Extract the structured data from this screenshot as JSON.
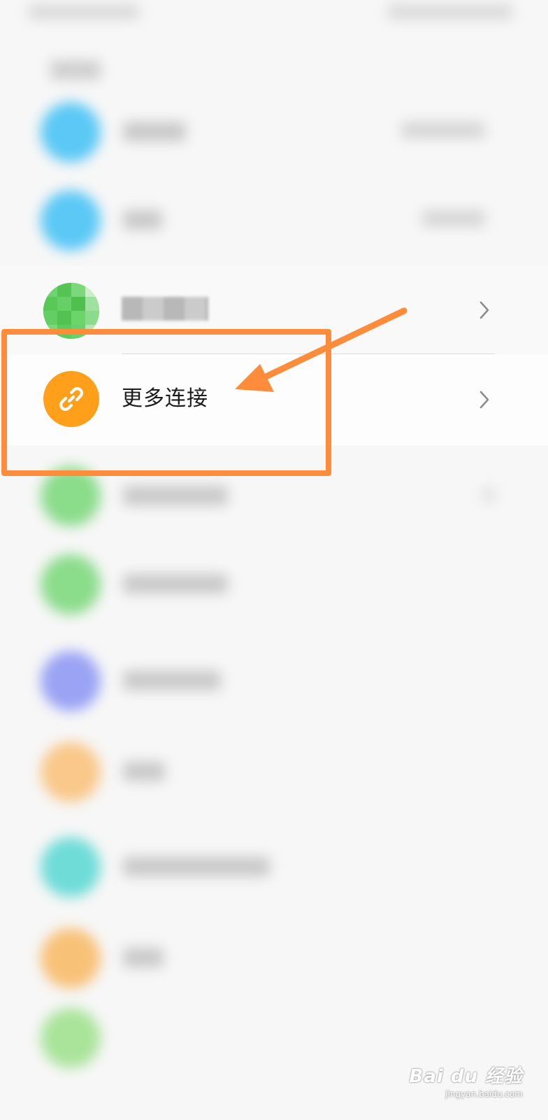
{
  "list": {
    "more_connections_label": "更多连接"
  },
  "colors": {
    "accent_orange": "#ff9f1a",
    "annotation_orange": "#ff8c3a",
    "blurred_icons": [
      "#5bc8f5",
      "#5bc8f5",
      "#5ccc5c",
      "#8bdc8b",
      "#8bdc8b",
      "#9aa3f4",
      "#f9c88a",
      "#6fdcd8",
      "#f8c178",
      "#a9e49a"
    ]
  },
  "watermark": {
    "brand": "Bai du 经验",
    "url": "jingyan.baidu.com"
  }
}
